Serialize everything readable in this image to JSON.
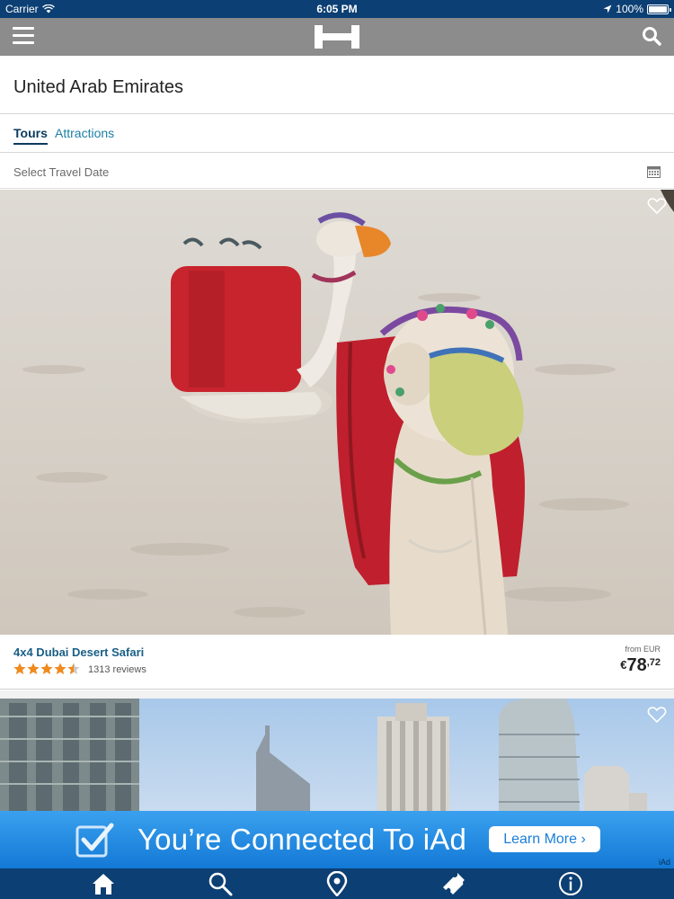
{
  "status_bar": {
    "carrier": "Carrier",
    "time": "6:05 PM",
    "battery": "100%",
    "battery_level": 1.0,
    "icons": [
      "wifi-icon",
      "location-arrow-icon",
      "battery-icon"
    ]
  },
  "nav": {
    "icons": [
      "menu-icon",
      "hotels-logo-icon",
      "search-icon"
    ]
  },
  "page": {
    "title": "United Arab Emirates"
  },
  "tabs": [
    {
      "label": "Tours",
      "active": true
    },
    {
      "label": "Attractions",
      "active": false
    }
  ],
  "date_filter": {
    "label": "Select Travel Date",
    "icon": "calendar-icon"
  },
  "cards": [
    {
      "title": "4x4 Dubai Desert Safari",
      "rating": 4.5,
      "max_rating": 5,
      "reviews": "1313 reviews",
      "price_from": "from EUR",
      "price_currency": "€",
      "price_int": "78",
      "price_dec": ",72",
      "favorite": false,
      "image": "camels-in-desert"
    },
    {
      "favorite": false,
      "image": "dubai-skyscrapers"
    }
  ],
  "ad": {
    "text": "You’re Connected To iAd",
    "button": "Learn More ›",
    "tag": "iAd"
  },
  "tab_bar": {
    "items": [
      "home-icon",
      "search-icon",
      "map-pin-icon",
      "ticket-icon",
      "info-icon"
    ]
  },
  "colors": {
    "status_bar": "#0c3f73",
    "nav_bar": "#8c8c8c",
    "link": "#1c7fa3",
    "active_tab": "#0b3a5e",
    "star": "#f08a1c",
    "ad_blue": "#1f86df"
  }
}
